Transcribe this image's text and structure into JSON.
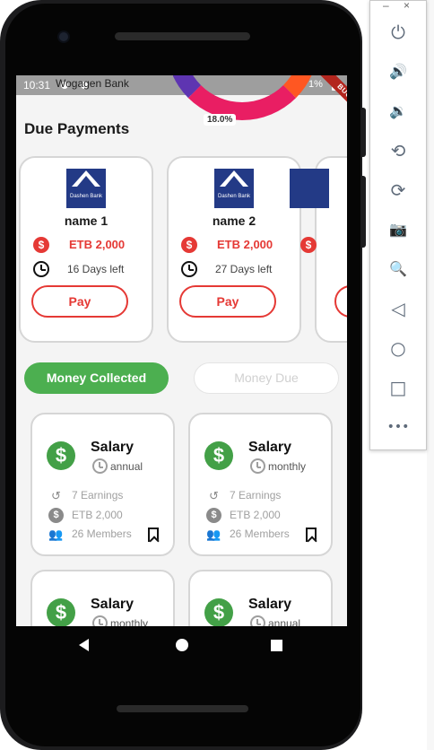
{
  "status_bar": {
    "time": "10:31",
    "app_title": "Wogagen Bank",
    "right_text": "1%",
    "debug_label": "BUG"
  },
  "chart_fragment": {
    "label": "18.0%"
  },
  "due_payments": {
    "title": "Due Payments",
    "cards": [
      {
        "logo_text": "Dashen Bank",
        "name": "name 1",
        "amount": "ETB 2,000",
        "days_left": "16 Days left",
        "pay_label": "Pay"
      },
      {
        "logo_text": "Dashen Bank",
        "name": "name 2",
        "amount": "ETB 2,000",
        "days_left": "27 Days left",
        "pay_label": "Pay"
      }
    ]
  },
  "toggle": {
    "active_label": "Money Collected",
    "inactive_label": "Money Due"
  },
  "collected": {
    "cards": [
      {
        "title": "Salary",
        "frequency": "annual",
        "earnings": "7 Earnings",
        "amount": "ETB 2,000",
        "members": "26 Members"
      },
      {
        "title": "Salary",
        "frequency": "monthly",
        "earnings": "7 Earnings",
        "amount": "ETB 2,000",
        "members": "26 Members"
      },
      {
        "title": "Salary",
        "frequency": "monthly"
      },
      {
        "title": "Salary",
        "frequency": "annual"
      }
    ]
  },
  "icons": {
    "dollar": "dollar-icon",
    "clock": "clock-icon",
    "history": "history-icon",
    "members": "group-icon",
    "bookmark": "bookmark-icon"
  },
  "colors": {
    "accent_red": "#e53935",
    "accent_green": "#4caf50",
    "bank_blue": "#233a86"
  },
  "emulator_toolbar": {
    "minimize": "–",
    "close": "×",
    "buttons": [
      "⏻",
      "🔊",
      "🔉",
      "⟲",
      "⟳",
      "📷",
      "🔍",
      "◁",
      "○",
      "□",
      "•••"
    ]
  }
}
